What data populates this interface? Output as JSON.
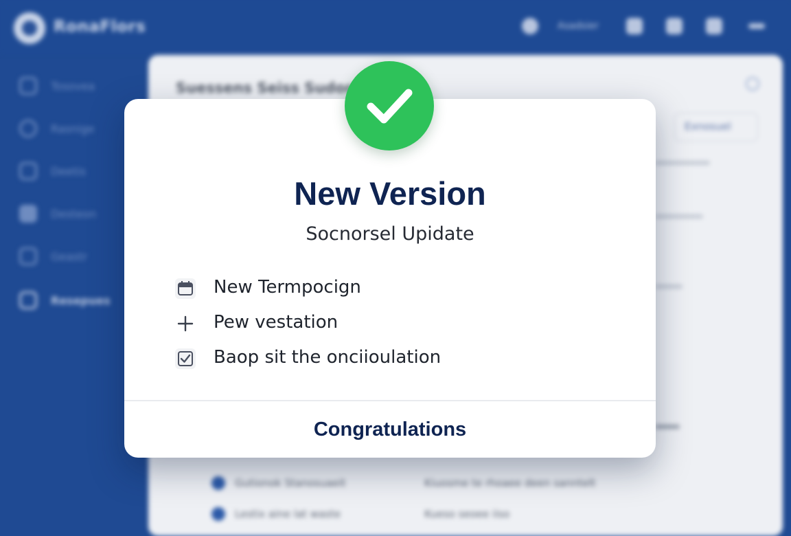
{
  "app": {
    "brand": "RonaFlors",
    "top_label": "Asadsier",
    "sidebar": {
      "items": [
        {
          "label": "Tosovea"
        },
        {
          "label": "Rasnige"
        },
        {
          "label": "Deetis"
        },
        {
          "label": "Desteon"
        },
        {
          "label": "Geastr"
        },
        {
          "label": "Resepues"
        }
      ]
    },
    "panel": {
      "title": "Suessens Seiss Sudor",
      "action_label": "Exnosuel",
      "rows": [
        {
          "a": "Gutionok Stanosuaeit",
          "b": "Kiuosme te rhoaee deen sanntelt"
        },
        {
          "a": "Lestix aine lat waste",
          "b": "Kueso seoee iiso"
        }
      ]
    }
  },
  "modal": {
    "title": "New Version",
    "subtitle": "Socnorsel Upidate",
    "features": [
      {
        "icon": "calendar-icon",
        "label": "New Termpocign"
      },
      {
        "icon": "sparkle-icon",
        "label": "Pew vestation"
      },
      {
        "icon": "checkbox-icon",
        "label": "Baop sit the onciioulation"
      }
    ],
    "footer_label": "Congratulations"
  },
  "colors": {
    "background_blue": "#1f4a93",
    "badge_green": "#2ec25a",
    "title_navy": "#0f2452"
  }
}
